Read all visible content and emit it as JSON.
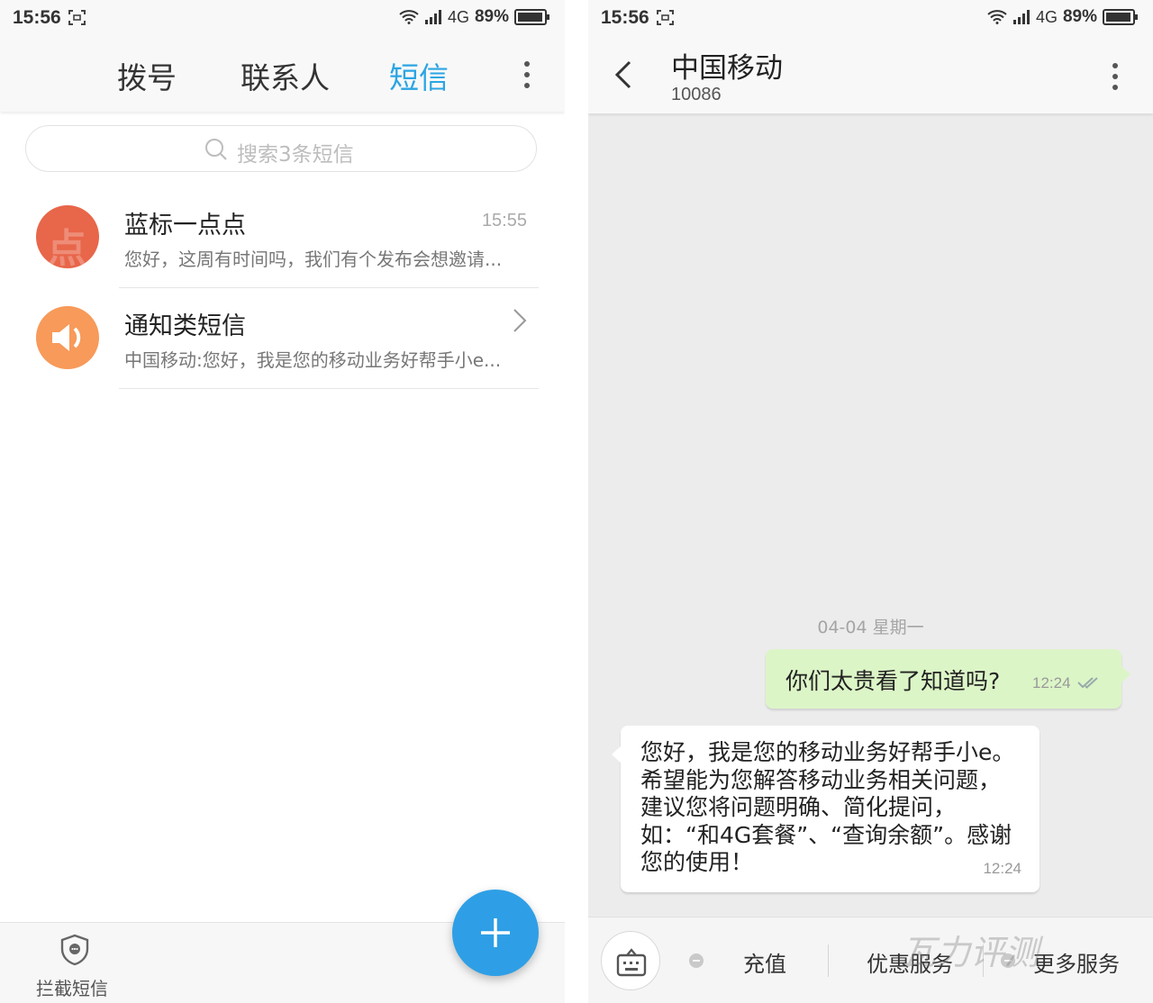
{
  "left": {
    "status": {
      "time": "15:56",
      "network": "4G",
      "battery": "89%"
    },
    "tabs": [
      {
        "label": "拨号",
        "active": false
      },
      {
        "label": "联系人",
        "active": false
      },
      {
        "label": "短信",
        "active": true
      }
    ],
    "search": {
      "placeholder": "搜索3条短信"
    },
    "conversations": [
      {
        "name": "蓝标一点点",
        "time": "15:55",
        "snippet": "您好，这周有时间吗，我们有个发布会想邀请...",
        "avatar_char": "点",
        "avatar_color": "#e8664a"
      },
      {
        "name": "通知类短信",
        "time": "",
        "snippet": "中国移动:您好，我是您的移动业务好帮手小e...",
        "avatar_icon": "speaker-icon",
        "avatar_color": "#f79a5a"
      }
    ],
    "bottom": {
      "block_label": "拦截短信"
    },
    "colors": {
      "accent": "#2ba5e3",
      "fab": "#2e9fe6"
    }
  },
  "right": {
    "status": {
      "time": "15:56",
      "network": "4G",
      "battery": "89%"
    },
    "contact": {
      "name": "中国移动",
      "number": "10086"
    },
    "date_separator": "04-04  星期一",
    "messages": [
      {
        "direction": "out",
        "text": "你们太贵看了知道吗?",
        "time": "12:24",
        "status_icon": "double-check-icon"
      },
      {
        "direction": "in",
        "text": "您好，我是您的移动业务好帮手小e。希望能为您解答移动业务相关问题，建议您将问题明确、简化提问，如：“和4G套餐”、“查询余额”。感谢您的使用！",
        "time": "12:24"
      }
    ],
    "menu": [
      {
        "label": "充值"
      },
      {
        "label": "优惠服务"
      },
      {
        "label": "更多服务"
      }
    ],
    "watermark": "瓦力评测",
    "colors": {
      "outgoing_bubble": "#dcf5c7",
      "incoming_bubble": "#ffffff",
      "background": "#ececec"
    }
  }
}
